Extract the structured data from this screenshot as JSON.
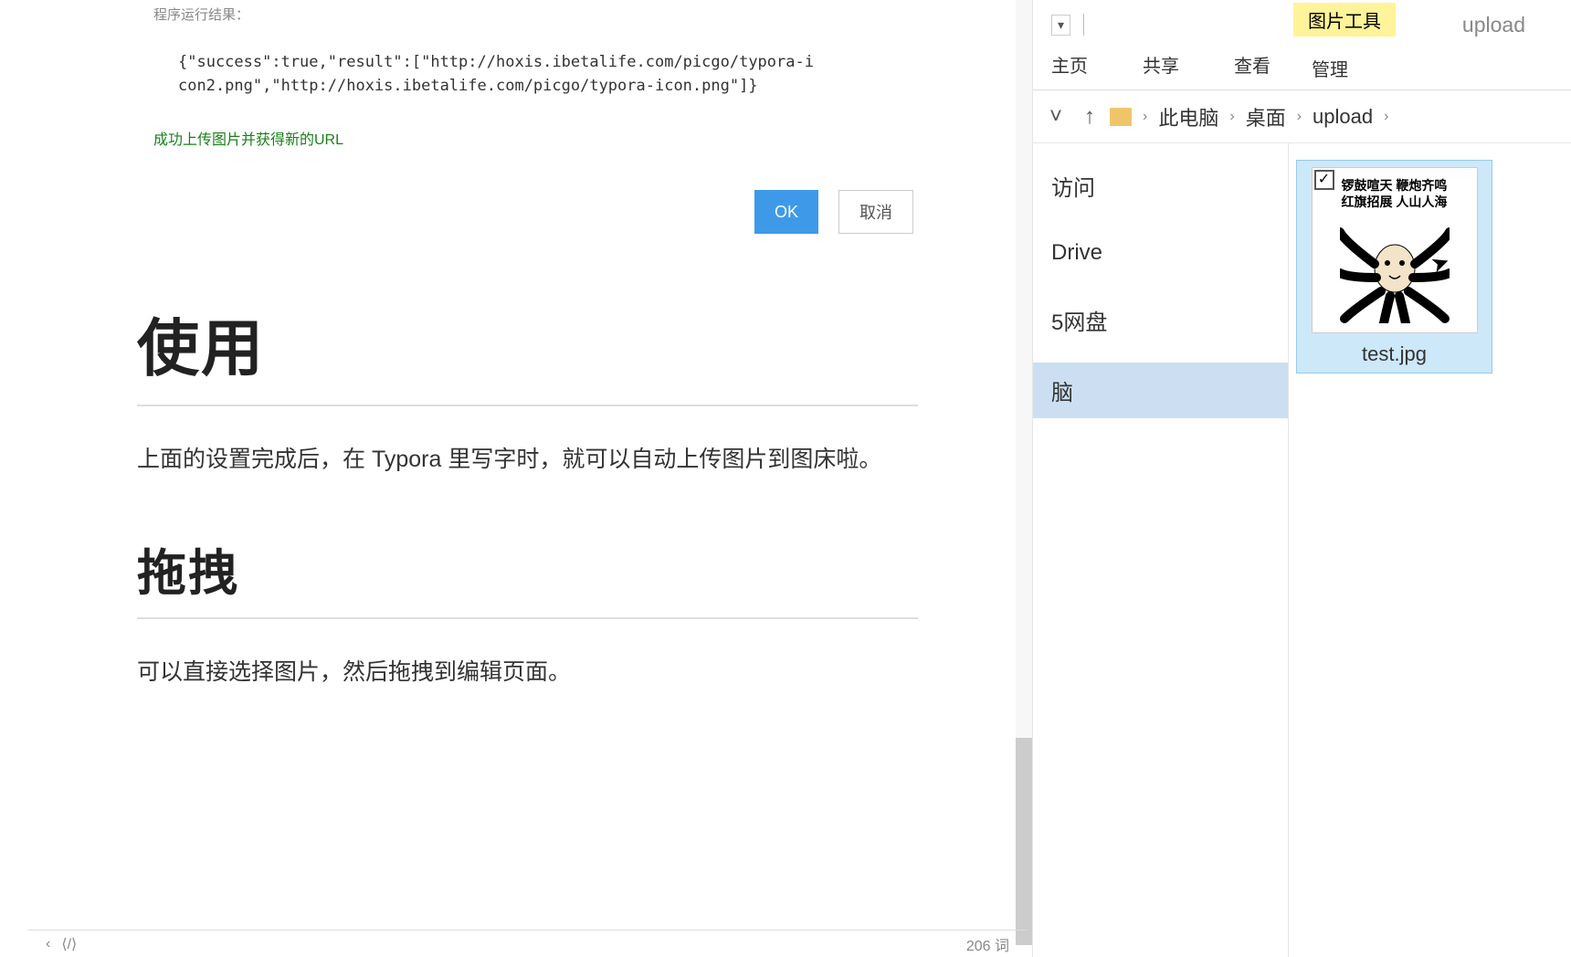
{
  "editor": {
    "result_label": "程序运行结果：",
    "result_code": "{\"success\":true,\"result\":[\"http://hoxis.ibetalife.com/picgo/typora-icon2.png\",\"http://hoxis.ibetalife.com/picgo/typora-icon.png\"]}",
    "success_msg": "成功上传图片并获得新的URL",
    "buttons": {
      "ok": "OK",
      "cancel": "取消"
    },
    "h1": "使用",
    "para1": "上面的设置完成后，在 Typora 里写字时，就可以自动上传图片到图床啦。",
    "h2": "拖拽",
    "para2": "可以直接选择图片，然后拖拽到编辑页面。",
    "status": {
      "back": "‹",
      "outline": "⟨/⟩",
      "words": "206 词"
    }
  },
  "explorer": {
    "dropdown": "▾",
    "title": "upload",
    "context_tab_label": "图片工具",
    "ribbon_tabs": [
      "主页",
      "共享",
      "查看",
      "管理"
    ],
    "breadcrumb": {
      "sep_first": "›",
      "parts": [
        "此电脑",
        "桌面",
        "upload"
      ],
      "sep": "›"
    },
    "sidebar": {
      "items": [
        "访问",
        "Drive",
        "5网盘",
        "脑"
      ],
      "selected_index": 3
    },
    "files": [
      {
        "name": "test.jpg",
        "thumb_text_line1": "锣鼓喧天 鞭炮齐鸣",
        "thumb_text_line2": "红旗招展 人山人海",
        "checked": true
      }
    ]
  }
}
